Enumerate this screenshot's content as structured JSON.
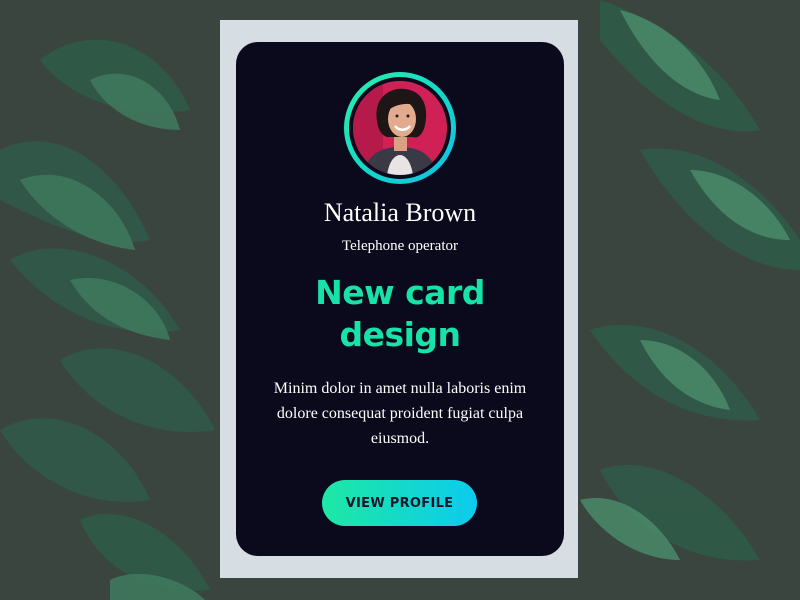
{
  "profile": {
    "name": "Natalia Brown",
    "role": "Telephone operator",
    "avatar_icon": "person-photo-icon"
  },
  "card": {
    "headline": "New card design",
    "description": "Minim dolor in amet nulla laboris enim dolore consequat proident fugiat culpa eiusmod.",
    "button_label": "VIEW PROFILE"
  },
  "colors": {
    "card_bg": "#0a0a1c",
    "accent": "#17e3a8",
    "accent_end": "#0ccbef",
    "frame_bg": "#d6dde3"
  }
}
